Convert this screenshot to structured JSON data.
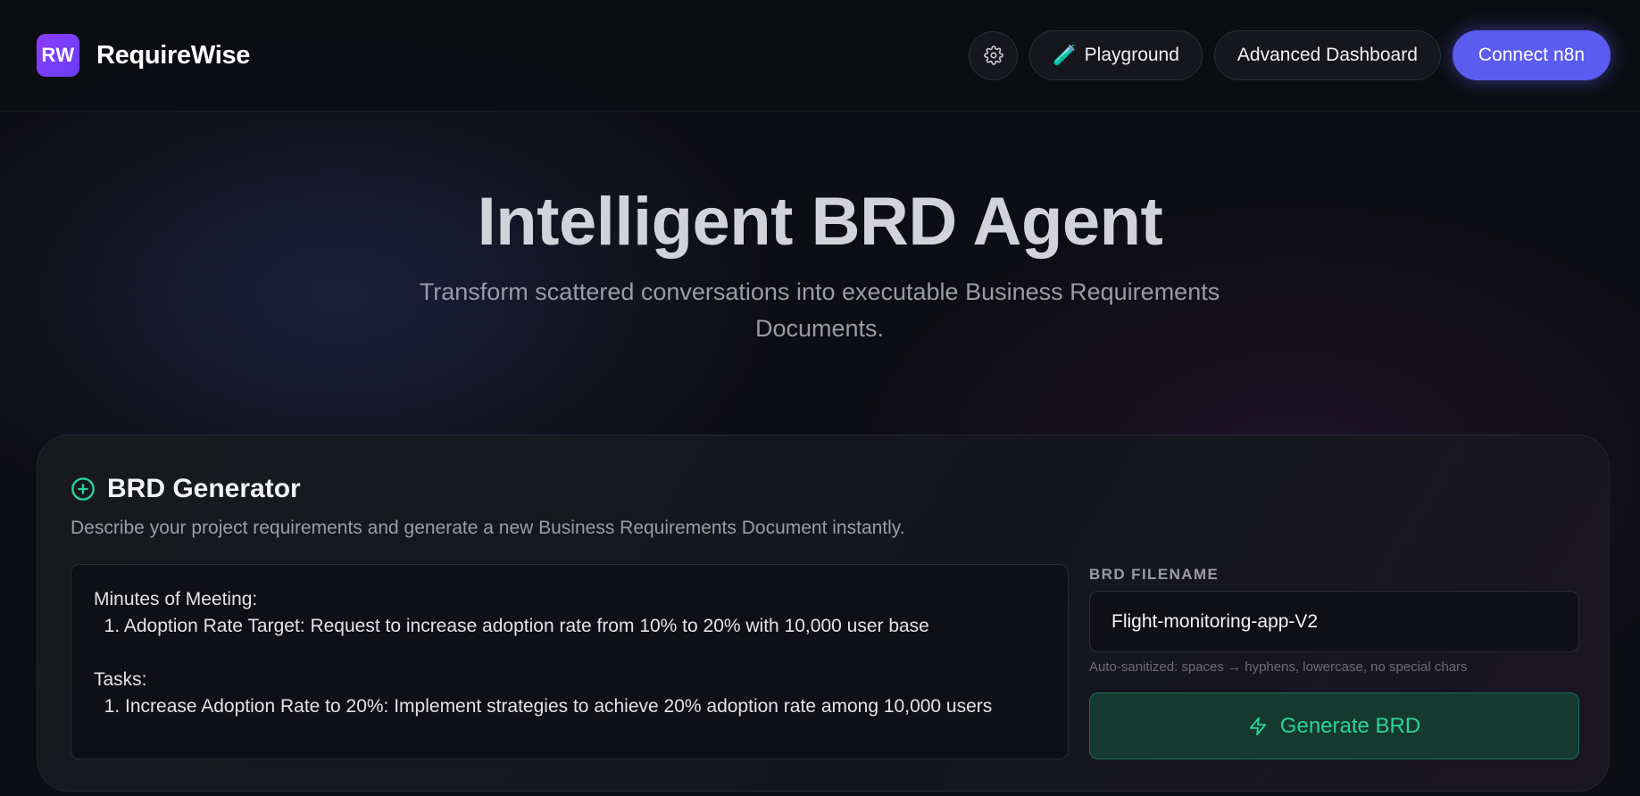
{
  "brand": {
    "logo_text": "RW",
    "name": "RequireWise"
  },
  "nav": {
    "settings_icon": "gear-icon",
    "playground_label": "Playground",
    "playground_icon": "🧪",
    "dashboard_label": "Advanced Dashboard",
    "connect_label": "Connect n8n"
  },
  "hero": {
    "title": "Intelligent BRD Agent",
    "subtitle": "Transform scattered conversations into executable Business Requirements Documents."
  },
  "generator": {
    "icon": "plus-circle-icon",
    "title": "BRD Generator",
    "description": "Describe your project requirements and generate a new Business Requirements Document instantly.",
    "input_text": "Minutes of Meeting:\n  1. Adoption Rate Target: Request to increase adoption rate from 10% to 20% with 10,000 user base\n\nTasks:\n  1. Increase Adoption Rate to 20%: Implement strategies to achieve 20% adoption rate among 10,000 users",
    "filename_label": "BRD FILENAME",
    "filename_value": "Flight-monitoring-app-V2",
    "filename_hint": "Auto-sanitized: spaces → hyphens, lowercase, no special chars",
    "generate_label": "Generate BRD",
    "generate_icon": "lightning-icon"
  },
  "colors": {
    "accent_primary": "#5b5cf0",
    "accent_green": "#2ad39a",
    "logo_gradient_start": "#8b3dff"
  }
}
